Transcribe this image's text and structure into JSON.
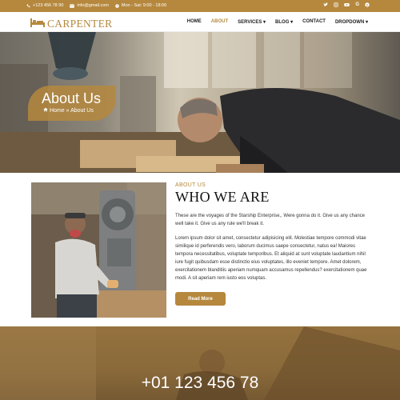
{
  "topbar": {
    "phone": "+123 456 78 90",
    "email": "info@gmail.com",
    "hours": "Mon - Sat: 9:00 - 18:00",
    "socials": [
      "twitter-icon",
      "instagram-icon",
      "youtube-icon",
      "google-icon",
      "pinterest-icon"
    ]
  },
  "brand": {
    "name": "CARPENTER",
    "accent": "#b5883e"
  },
  "nav": {
    "items": [
      {
        "label": "HOME"
      },
      {
        "label": "ABOUT"
      },
      {
        "label": "SERVICES"
      },
      {
        "label": "BLOG"
      },
      {
        "label": "CONTACT"
      },
      {
        "label": "DROPDOWN"
      }
    ],
    "active": "ABOUT"
  },
  "hero": {
    "title": "About Us",
    "breadcrumb_home": "Home",
    "breadcrumb_sep": "»",
    "breadcrumb_current": "About Us"
  },
  "about": {
    "eyebrow": "ABOUT US",
    "title": "WHO WE ARE",
    "lead": "These are the voyages of the Starship Enterprise,. Were gonna do it. Give us any chance well take it. Give us any rule we'll break it.",
    "body": "Lorem ipsum dolor sit amet, consectetur adipisicing elit. Molestiae tempore commodi vitae similique id perferendis vero, laborum ducimus saepe consectetur, natus ea! Maiores tempora necessitatibus, voluptate temporibus. Et aliquid at sunt voluptate laudantium nihil iure fugit quibusdam esse distinctio eius voluptates, illo eveniet tempore. Amet dolorem, exercitationem blanditiis aperiam numquam accusamus repellendus? exercitationem quae modi. A sit aperiam rem iusto eos voluptas.",
    "button": "Read More"
  },
  "contact_band": {
    "phone": "+01 123 456 78"
  }
}
